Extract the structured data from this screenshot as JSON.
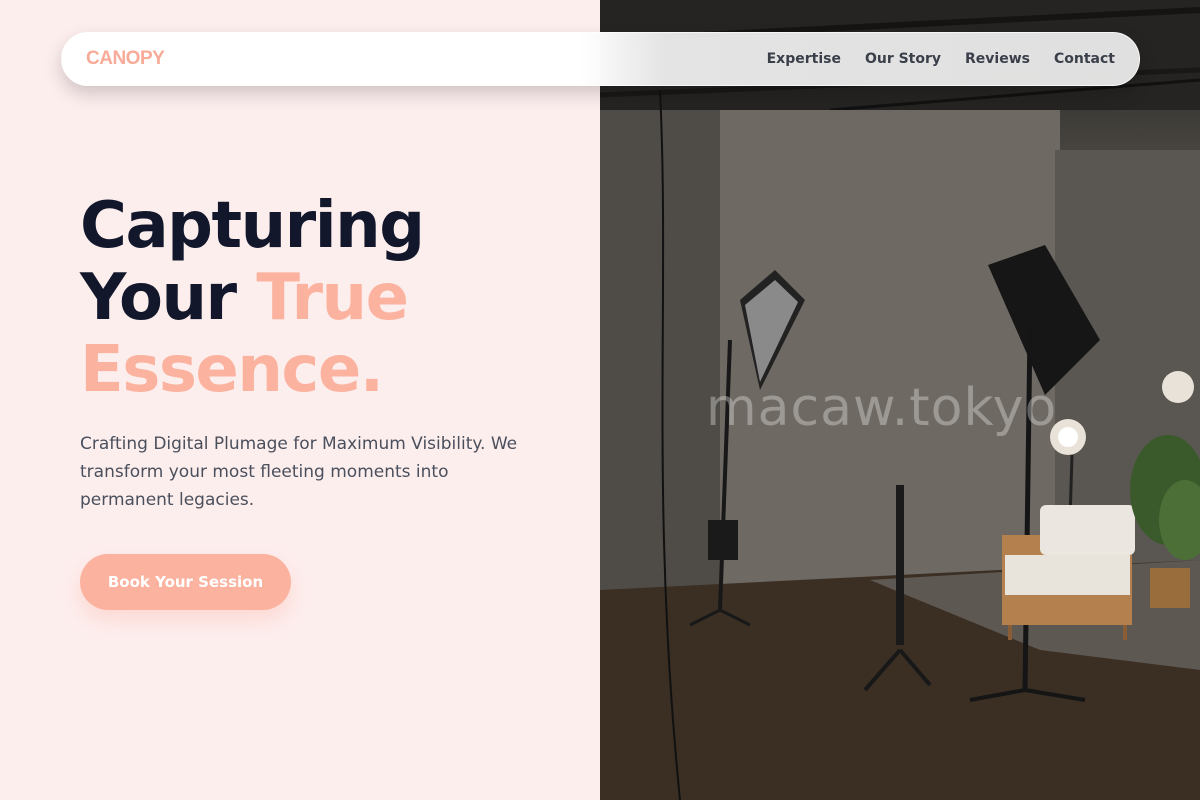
{
  "brand": {
    "name": "CANOPY"
  },
  "nav": {
    "links": [
      "Expertise",
      "Our Story",
      "Reviews",
      "Contact"
    ]
  },
  "hero": {
    "title_line1": "Capturing",
    "title_line2_a": "Your ",
    "title_line2_b": "True",
    "title_line3": "Essence.",
    "subtitle": "Crafting Digital Plumage for Maximum Visibility. We transform your most fleeting moments into permanent legacies.",
    "cta_label": "Book Your Session"
  },
  "image": {
    "watermark": "macaw.tokyo"
  },
  "colors": {
    "accent": "#fbb3a0",
    "heading": "#12172b",
    "background": "#fdeeee"
  }
}
